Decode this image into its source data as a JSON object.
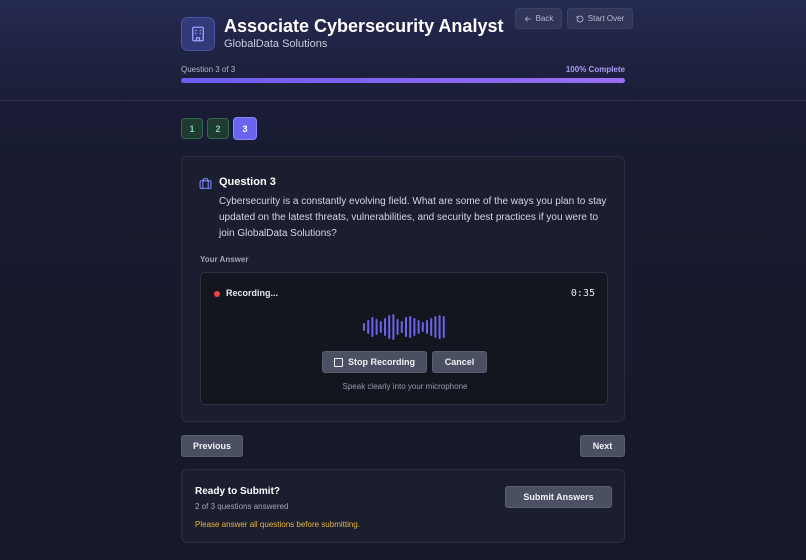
{
  "header": {
    "title": "Associate Cybersecurity Analyst",
    "company": "GlobalData Solutions",
    "back_label": "Back",
    "start_over_label": "Start Over"
  },
  "progress": {
    "label": "Question 3 of 3",
    "percent_label": "100% Complete",
    "value": 1.0,
    "accent": "#7c5cf0"
  },
  "question_nav": [
    {
      "label": "1",
      "state": "answered"
    },
    {
      "label": "2",
      "state": "answered"
    },
    {
      "label": "3",
      "state": "current"
    }
  ],
  "question": {
    "title": "Question 3",
    "text": "Cybersecurity is a constantly evolving field. What are some of the ways you plan to stay updated on the latest threats, vulnerabilities, and security best practices if you were to join GlobalData Solutions?",
    "answer_label": "Your Answer"
  },
  "recorder": {
    "status": "Recording...",
    "timer": "0:35",
    "stop_label": "Stop Recording",
    "cancel_label": "Cancel",
    "hint": "Speak clearly into your microphone",
    "wave_color": "#6b63e8",
    "record_color": "#ef4444"
  },
  "navigation": {
    "previous_label": "Previous",
    "next_label": "Next"
  },
  "submit": {
    "title": "Ready to Submit?",
    "count": "2 of 3 questions answered",
    "warning": "Please answer all questions before submitting.",
    "button_label": "Submit Answers",
    "warning_color": "#e7b43c"
  }
}
